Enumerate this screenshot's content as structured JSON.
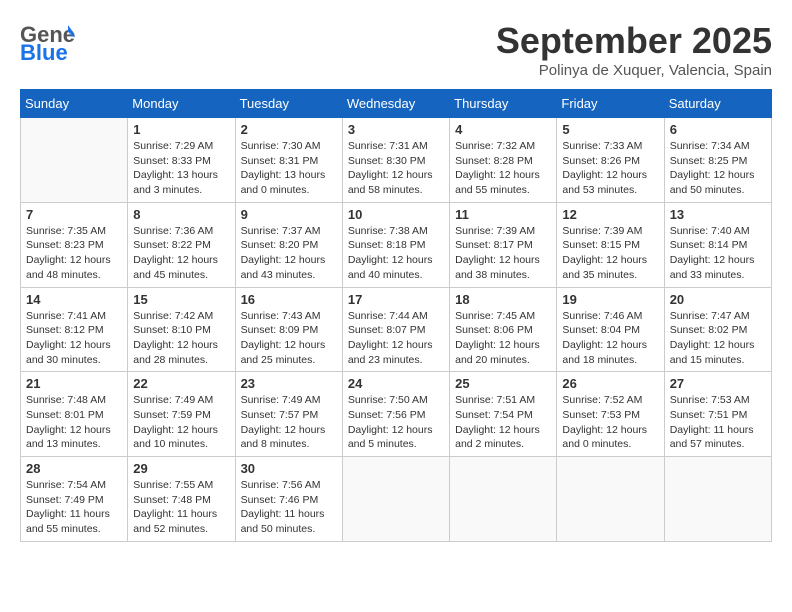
{
  "header": {
    "logo_general": "General",
    "logo_blue": "Blue",
    "month_title": "September 2025",
    "location": "Polinya de Xuquer, Valencia, Spain"
  },
  "days_of_week": [
    "Sunday",
    "Monday",
    "Tuesday",
    "Wednesday",
    "Thursday",
    "Friday",
    "Saturday"
  ],
  "weeks": [
    [
      {
        "day": "",
        "info": ""
      },
      {
        "day": "1",
        "info": "Sunrise: 7:29 AM\nSunset: 8:33 PM\nDaylight: 13 hours\nand 3 minutes."
      },
      {
        "day": "2",
        "info": "Sunrise: 7:30 AM\nSunset: 8:31 PM\nDaylight: 13 hours\nand 0 minutes."
      },
      {
        "day": "3",
        "info": "Sunrise: 7:31 AM\nSunset: 8:30 PM\nDaylight: 12 hours\nand 58 minutes."
      },
      {
        "day": "4",
        "info": "Sunrise: 7:32 AM\nSunset: 8:28 PM\nDaylight: 12 hours\nand 55 minutes."
      },
      {
        "day": "5",
        "info": "Sunrise: 7:33 AM\nSunset: 8:26 PM\nDaylight: 12 hours\nand 53 minutes."
      },
      {
        "day": "6",
        "info": "Sunrise: 7:34 AM\nSunset: 8:25 PM\nDaylight: 12 hours\nand 50 minutes."
      }
    ],
    [
      {
        "day": "7",
        "info": "Sunrise: 7:35 AM\nSunset: 8:23 PM\nDaylight: 12 hours\nand 48 minutes."
      },
      {
        "day": "8",
        "info": "Sunrise: 7:36 AM\nSunset: 8:22 PM\nDaylight: 12 hours\nand 45 minutes."
      },
      {
        "day": "9",
        "info": "Sunrise: 7:37 AM\nSunset: 8:20 PM\nDaylight: 12 hours\nand 43 minutes."
      },
      {
        "day": "10",
        "info": "Sunrise: 7:38 AM\nSunset: 8:18 PM\nDaylight: 12 hours\nand 40 minutes."
      },
      {
        "day": "11",
        "info": "Sunrise: 7:39 AM\nSunset: 8:17 PM\nDaylight: 12 hours\nand 38 minutes."
      },
      {
        "day": "12",
        "info": "Sunrise: 7:39 AM\nSunset: 8:15 PM\nDaylight: 12 hours\nand 35 minutes."
      },
      {
        "day": "13",
        "info": "Sunrise: 7:40 AM\nSunset: 8:14 PM\nDaylight: 12 hours\nand 33 minutes."
      }
    ],
    [
      {
        "day": "14",
        "info": "Sunrise: 7:41 AM\nSunset: 8:12 PM\nDaylight: 12 hours\nand 30 minutes."
      },
      {
        "day": "15",
        "info": "Sunrise: 7:42 AM\nSunset: 8:10 PM\nDaylight: 12 hours\nand 28 minutes."
      },
      {
        "day": "16",
        "info": "Sunrise: 7:43 AM\nSunset: 8:09 PM\nDaylight: 12 hours\nand 25 minutes."
      },
      {
        "day": "17",
        "info": "Sunrise: 7:44 AM\nSunset: 8:07 PM\nDaylight: 12 hours\nand 23 minutes."
      },
      {
        "day": "18",
        "info": "Sunrise: 7:45 AM\nSunset: 8:06 PM\nDaylight: 12 hours\nand 20 minutes."
      },
      {
        "day": "19",
        "info": "Sunrise: 7:46 AM\nSunset: 8:04 PM\nDaylight: 12 hours\nand 18 minutes."
      },
      {
        "day": "20",
        "info": "Sunrise: 7:47 AM\nSunset: 8:02 PM\nDaylight: 12 hours\nand 15 minutes."
      }
    ],
    [
      {
        "day": "21",
        "info": "Sunrise: 7:48 AM\nSunset: 8:01 PM\nDaylight: 12 hours\nand 13 minutes."
      },
      {
        "day": "22",
        "info": "Sunrise: 7:49 AM\nSunset: 7:59 PM\nDaylight: 12 hours\nand 10 minutes."
      },
      {
        "day": "23",
        "info": "Sunrise: 7:49 AM\nSunset: 7:57 PM\nDaylight: 12 hours\nand 8 minutes."
      },
      {
        "day": "24",
        "info": "Sunrise: 7:50 AM\nSunset: 7:56 PM\nDaylight: 12 hours\nand 5 minutes."
      },
      {
        "day": "25",
        "info": "Sunrise: 7:51 AM\nSunset: 7:54 PM\nDaylight: 12 hours\nand 2 minutes."
      },
      {
        "day": "26",
        "info": "Sunrise: 7:52 AM\nSunset: 7:53 PM\nDaylight: 12 hours\nand 0 minutes."
      },
      {
        "day": "27",
        "info": "Sunrise: 7:53 AM\nSunset: 7:51 PM\nDaylight: 11 hours\nand 57 minutes."
      }
    ],
    [
      {
        "day": "28",
        "info": "Sunrise: 7:54 AM\nSunset: 7:49 PM\nDaylight: 11 hours\nand 55 minutes."
      },
      {
        "day": "29",
        "info": "Sunrise: 7:55 AM\nSunset: 7:48 PM\nDaylight: 11 hours\nand 52 minutes."
      },
      {
        "day": "30",
        "info": "Sunrise: 7:56 AM\nSunset: 7:46 PM\nDaylight: 11 hours\nand 50 minutes."
      },
      {
        "day": "",
        "info": ""
      },
      {
        "day": "",
        "info": ""
      },
      {
        "day": "",
        "info": ""
      },
      {
        "day": "",
        "info": ""
      }
    ]
  ]
}
